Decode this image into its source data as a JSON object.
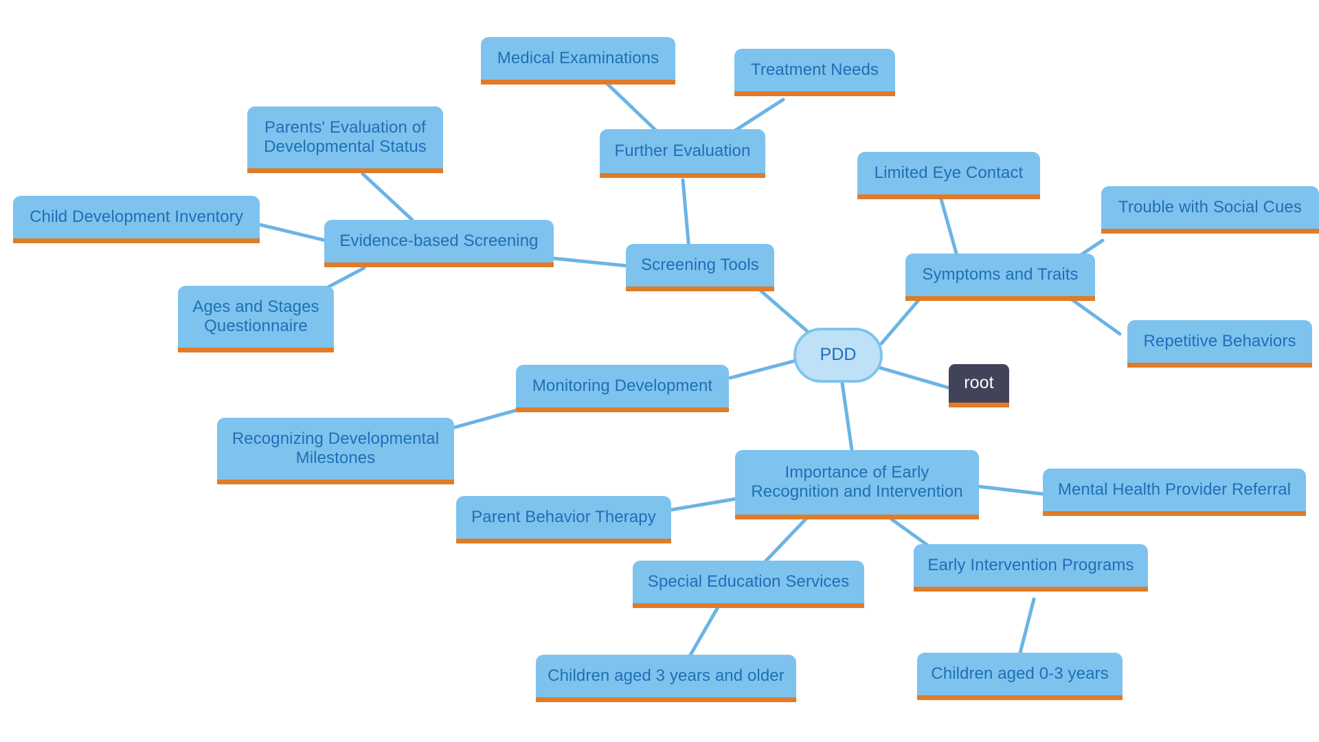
{
  "diagram": {
    "title": "PDD Mind Map",
    "background_color": "#ffffff",
    "node_fill": "#7ec3ee",
    "node_text_color": "#1f6fb5",
    "node_accent_color": "#e07b27",
    "root_fill": "#414459",
    "root_text_color": "#ffffff",
    "center_fill": "#bfe1f8",
    "edge_color": "#6bb4e4"
  },
  "nodes": {
    "center": {
      "label": "PDD"
    },
    "root": {
      "label": "root"
    },
    "medical_examinations": {
      "label": "Medical Examinations"
    },
    "treatment_needs": {
      "label": "Treatment Needs"
    },
    "further_evaluation": {
      "label": "Further Evaluation"
    },
    "parents_evaluation": {
      "label": "Parents' Evaluation of\nDevelopmental Status"
    },
    "child_development_inventory": {
      "label": "Child Development Inventory"
    },
    "evidence_based_screening": {
      "label": "Evidence-based Screening"
    },
    "ages_and_stages": {
      "label": "Ages and Stages\nQuestionnaire"
    },
    "screening_tools": {
      "label": "Screening Tools"
    },
    "limited_eye_contact": {
      "label": "Limited Eye Contact"
    },
    "trouble_social_cues": {
      "label": "Trouble with Social Cues"
    },
    "symptoms_and_traits": {
      "label": "Symptoms and Traits"
    },
    "repetitive_behaviors": {
      "label": "Repetitive Behaviors"
    },
    "monitoring_development": {
      "label": "Monitoring Development"
    },
    "recognizing_milestones": {
      "label": "Recognizing Developmental\nMilestones"
    },
    "importance_early": {
      "label": "Importance of Early\nRecognition and Intervention"
    },
    "mental_health_referral": {
      "label": "Mental Health Provider Referral"
    },
    "parent_behavior_therapy": {
      "label": "Parent Behavior Therapy"
    },
    "special_education": {
      "label": "Special Education Services"
    },
    "early_intervention": {
      "label": "Early Intervention Programs"
    },
    "children_3_plus": {
      "label": "Children aged 3 years and older"
    },
    "children_0_3": {
      "label": "Children aged 0-3 years"
    }
  },
  "edges": [
    {
      "from": "center",
      "to": "root"
    },
    {
      "from": "center",
      "to": "screening_tools"
    },
    {
      "from": "center",
      "to": "symptoms_and_traits"
    },
    {
      "from": "center",
      "to": "monitoring_development"
    },
    {
      "from": "center",
      "to": "importance_early"
    },
    {
      "from": "screening_tools",
      "to": "further_evaluation"
    },
    {
      "from": "screening_tools",
      "to": "evidence_based_screening"
    },
    {
      "from": "further_evaluation",
      "to": "medical_examinations"
    },
    {
      "from": "further_evaluation",
      "to": "treatment_needs"
    },
    {
      "from": "evidence_based_screening",
      "to": "parents_evaluation"
    },
    {
      "from": "evidence_based_screening",
      "to": "child_development_inventory"
    },
    {
      "from": "evidence_based_screening",
      "to": "ages_and_stages"
    },
    {
      "from": "symptoms_and_traits",
      "to": "limited_eye_contact"
    },
    {
      "from": "symptoms_and_traits",
      "to": "trouble_social_cues"
    },
    {
      "from": "symptoms_and_traits",
      "to": "repetitive_behaviors"
    },
    {
      "from": "monitoring_development",
      "to": "recognizing_milestones"
    },
    {
      "from": "importance_early",
      "to": "mental_health_referral"
    },
    {
      "from": "importance_early",
      "to": "parent_behavior_therapy"
    },
    {
      "from": "importance_early",
      "to": "special_education"
    },
    {
      "from": "importance_early",
      "to": "early_intervention"
    },
    {
      "from": "special_education",
      "to": "children_3_plus"
    },
    {
      "from": "early_intervention",
      "to": "children_0_3"
    }
  ]
}
